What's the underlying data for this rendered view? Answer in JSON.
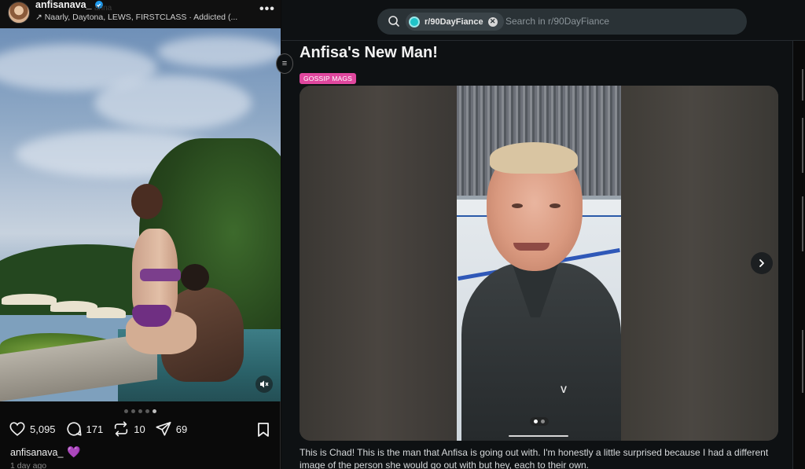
{
  "threads_post": {
    "username": "anfisanava_",
    "ghost_text": "arina",
    "music": "Naarly, Daytona, LEWS, FIRSTCLASS · Addicted (...",
    "more_label": "•••",
    "stats": {
      "likes": "5,095",
      "comments": "171",
      "reposts": "10",
      "shares": "69"
    },
    "caption_user": "anfisanava_",
    "caption_emoji": "💜",
    "timestamp": "1 day ago",
    "carousel": {
      "count": 5,
      "active_index": 4
    },
    "mute_icon": "mute-icon"
  },
  "reddit_post": {
    "search": {
      "community": "r/90DayFiance",
      "placeholder": "Search in r/90DayFiance"
    },
    "title": "Anfisa's New Man!",
    "flair": "GOSSIP MAGS",
    "flair_color": "#e0479e",
    "gallery": {
      "count": 2,
      "active_index": 0
    },
    "body": "This is Chad! This is the man that Anfisa is going out with. I'm honestly a little surprised because I had a different image of the person she would go out with but hey, each to their own."
  }
}
